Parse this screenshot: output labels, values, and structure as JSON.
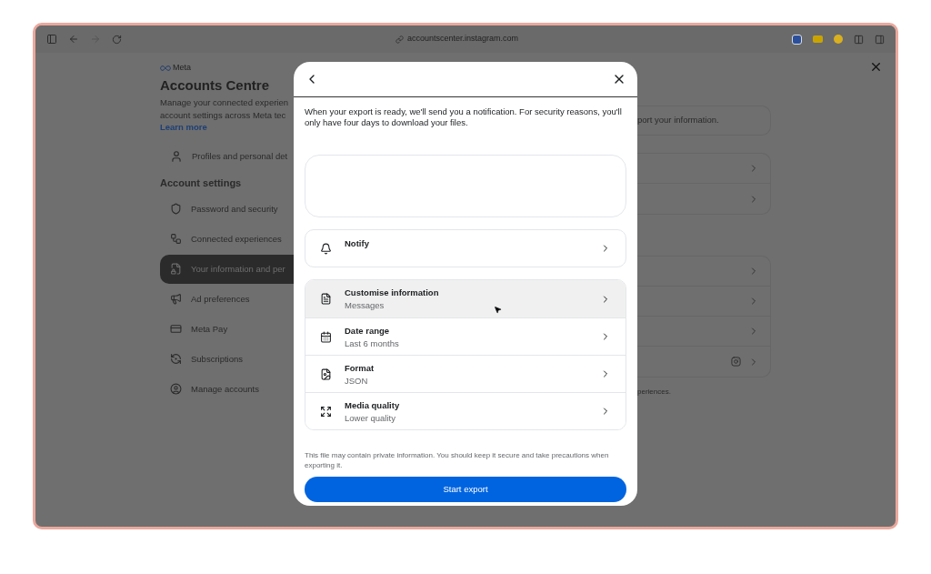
{
  "browser": {
    "url": "accountscenter.instagram.com"
  },
  "background": {
    "brand": "Meta",
    "title": "Accounts Centre",
    "description": [
      "Manage your connected experien",
      "account settings across Meta tec"
    ],
    "learn_more": "Learn more",
    "profiles_item": "Profiles and personal det",
    "section_title": "Account settings",
    "menu": [
      {
        "label": "Password and security",
        "kind": "shield",
        "selected": false
      },
      {
        "label": "Connected experiences",
        "kind": "nodes",
        "selected": false
      },
      {
        "label": "Your information and per",
        "kind": "file-lock",
        "selected": true
      },
      {
        "label": "Ad preferences",
        "kind": "megaphone",
        "selected": false
      },
      {
        "label": "Meta Pay",
        "kind": "card",
        "selected": false
      },
      {
        "label": "Subscriptions",
        "kind": "dollar-cycle",
        "selected": false
      },
      {
        "label": "Manage accounts",
        "kind": "user-circle",
        "selected": false
      }
    ],
    "notice": "port your information.",
    "groups": [
      [
        {
          "kind": "link"
        },
        {
          "kind": "link"
        }
      ],
      [
        {
          "kind": "link"
        },
        {
          "kind": "link"
        },
        {
          "kind": "link"
        },
        {
          "kind": "instagram"
        }
      ]
    ],
    "footnote": "periences."
  },
  "dialog": {
    "description": "When your export is ready, we'll send you a notification. For security reasons, you'll only have four days to download your files.",
    "notify": {
      "label": "Notify"
    },
    "options": [
      {
        "label": "Customise information",
        "value": "Messages",
        "kind": "document",
        "selected": true
      },
      {
        "label": "Date range",
        "value": "Last 6 months",
        "kind": "calendar",
        "selected": false
      },
      {
        "label": "Format",
        "value": "JSON",
        "kind": "image-file",
        "selected": false
      },
      {
        "label": "Media quality",
        "value": "Lower quality",
        "kind": "expand",
        "selected": false
      }
    ],
    "disclaimer": "This file may contain private information. You should keep it secure and take precautions when exporting it.",
    "button": "Start export"
  }
}
